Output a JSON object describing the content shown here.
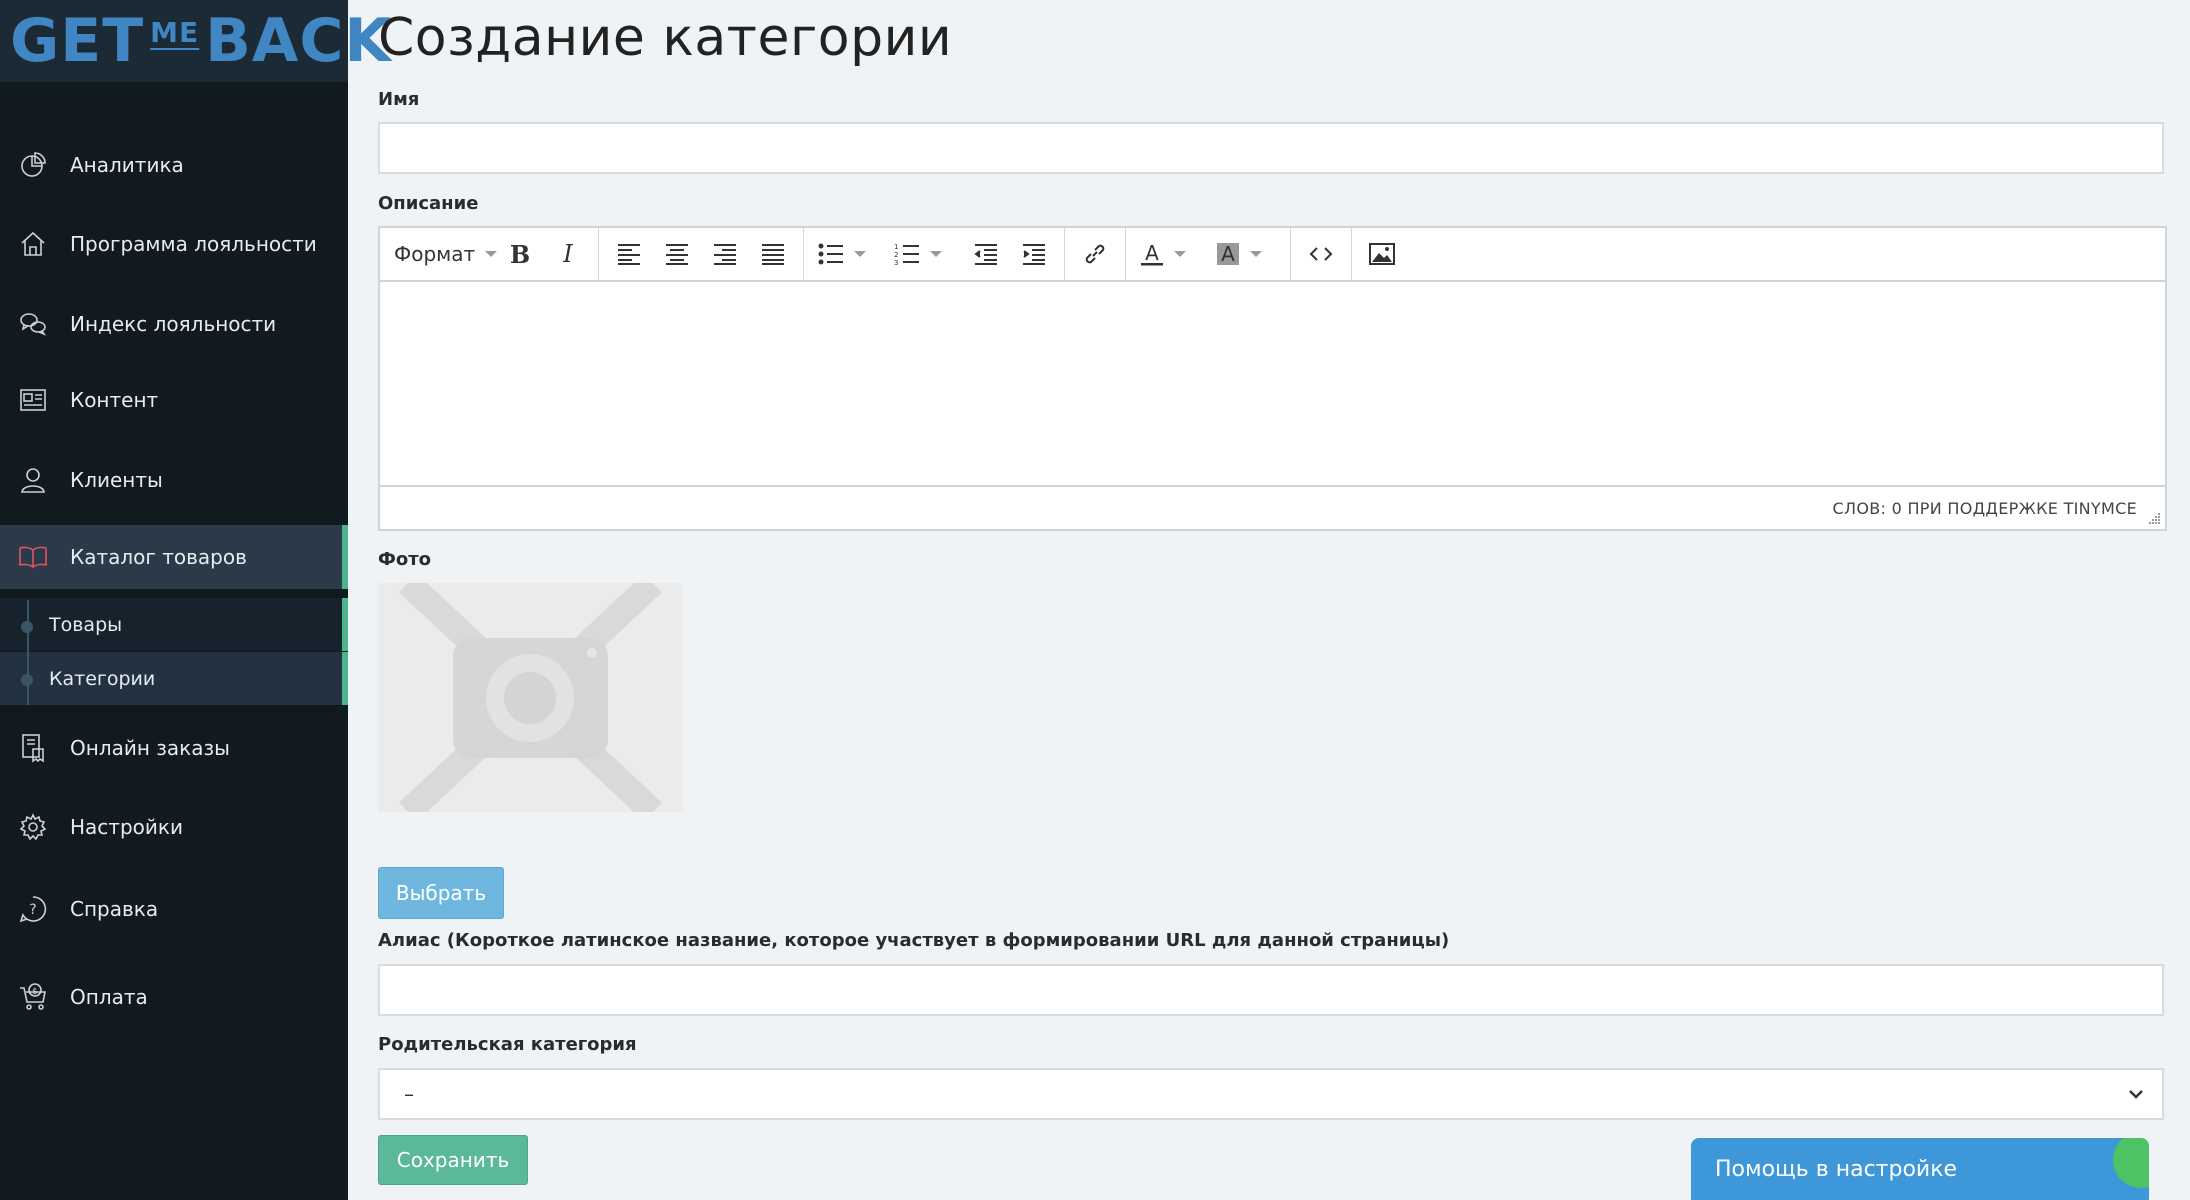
{
  "logo": {
    "part1": "GET",
    "part2": "ME",
    "part3": "BACK"
  },
  "sidebar": {
    "items": [
      {
        "label": "Аналитика",
        "icon": "pie-chart-icon"
      },
      {
        "label": "Программа лояльности",
        "icon": "home-icon"
      },
      {
        "label": "Индекс лояльности",
        "icon": "chat-bubbles-icon"
      },
      {
        "label": "Контент",
        "icon": "newspaper-icon"
      },
      {
        "label": "Клиенты",
        "icon": "user-icon"
      },
      {
        "label": "Каталог товаров",
        "icon": "book-icon",
        "active": true
      },
      {
        "label": "Онлайн заказы",
        "icon": "receipt-icon"
      },
      {
        "label": "Настройки",
        "icon": "gear-icon"
      },
      {
        "label": "Справка",
        "icon": "question-icon"
      },
      {
        "label": "Оплата",
        "icon": "cart-dollar-icon"
      }
    ],
    "subitems": [
      {
        "label": "Товары"
      },
      {
        "label": "Категории",
        "active": true
      }
    ]
  },
  "main": {
    "title": "Создание категории",
    "name_label": "Имя",
    "name_value": "",
    "description_label": "Описание",
    "editor": {
      "format_label": "Формат",
      "status": "СЛОВ: 0 ПРИ ПОДДЕРЖКЕ TINYMCE"
    },
    "photo_label": "Фото",
    "choose_button": "Выбрать",
    "alias_label": "Алиас (Короткое латинское название, которое участвует в формировании URL для данной страницы)",
    "alias_value": "",
    "parent_label": "Родительская категория",
    "parent_value": "–",
    "save_button": "Сохранить"
  },
  "help_widget": {
    "label": "Помощь в настройке"
  },
  "colors": {
    "sidebar_bg": "#111a1f",
    "active_bg": "#2a3a49",
    "accent_green": "#4db38d",
    "choose_button": "#6fb7de",
    "save_button": "#5bb898",
    "help_widget": "#3d97d8",
    "logo_blue": "#3f86c2",
    "active_icon": "#e0535f"
  }
}
